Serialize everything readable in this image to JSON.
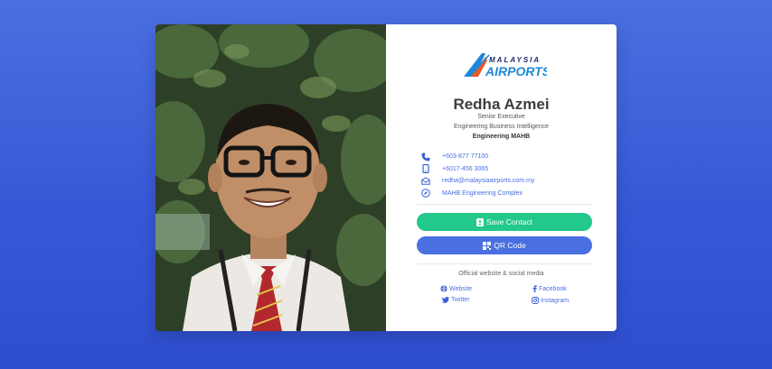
{
  "profile": {
    "name": "Redha Azmei",
    "title": "Senior Executive",
    "department": "Engineering Business Intelligence",
    "unit": "Engineering MAHB"
  },
  "logo": {
    "line1": "MALAYSIA",
    "line2": "AIRPORTS"
  },
  "contacts": [
    {
      "icon": "phone-icon",
      "text": "+603-877 77100"
    },
    {
      "icon": "mobile-icon",
      "text": "+6017-456 3065"
    },
    {
      "icon": "email-icon",
      "text": "redha@malaysiaairports.com.my"
    },
    {
      "icon": "compass-icon",
      "text": "MAHB Engineering Complex"
    }
  ],
  "actions": {
    "save_label": "Save Contact",
    "qr_label": "QR Code"
  },
  "social": {
    "title": "Official website & social media",
    "links": [
      {
        "icon": "globe-icon",
        "label": "Website"
      },
      {
        "icon": "facebook-icon",
        "label": "Facebook"
      },
      {
        "icon": "twitter-icon",
        "label": "Twitter"
      },
      {
        "icon": "instagram-icon",
        "label": "Instagram"
      }
    ]
  },
  "colors": {
    "background": "#3f63dc",
    "save_button": "#22c98a",
    "qr_button": "#4a6fe0",
    "link": "#4a6ee0",
    "logo_blue": "#1e88d8"
  }
}
